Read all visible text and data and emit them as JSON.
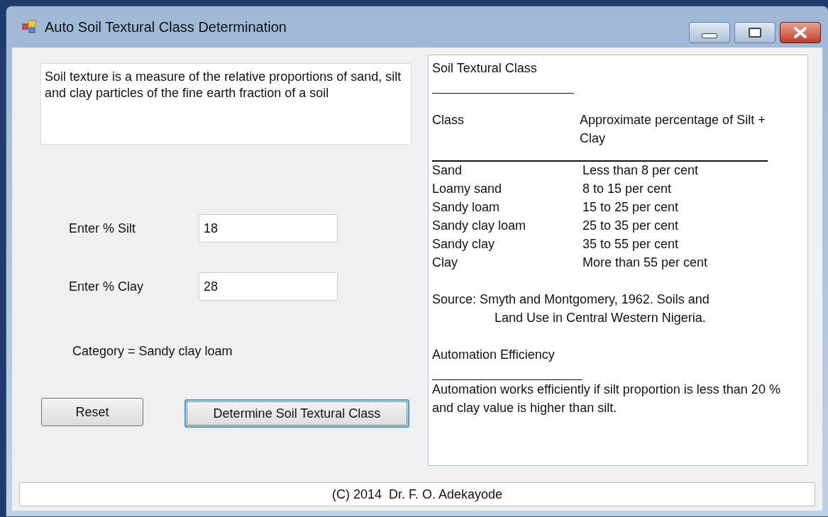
{
  "window": {
    "title": "Auto Soil Textural Class Determination"
  },
  "description": "Soil texture is a measure of the relative proportions of sand, silt and clay particles of the fine earth fraction of a soil",
  "fields": [
    {
      "label": "Enter % Silt",
      "value": "18"
    },
    {
      "label": "Enter % Clay",
      "value": "28"
    }
  ],
  "result": "Category = Sandy clay loam",
  "buttons": [
    {
      "label": "Reset",
      "focused": false
    },
    {
      "label": "Determine Soil Textural Class",
      "focused": true
    }
  ],
  "info_panel": {
    "heading": "Soil Textural Class",
    "columns": [
      "Class",
      "Approximate percentage of Silt + Clay"
    ],
    "rows": [
      {
        "class": "Sand",
        "range": "Less than 8 per cent"
      },
      {
        "class": "Loamy sand",
        "range": "8 to 15 per cent"
      },
      {
        "class": "Sandy loam",
        "range": "15 to 25 per cent"
      },
      {
        "class": "Sandy clay loam",
        "range": "25 to 35 per cent"
      },
      {
        "class": "Sandy clay",
        "range": "35 to 55 per cent"
      },
      {
        "class": "Clay",
        "range": "More than 55 per cent"
      }
    ],
    "source_lines": [
      "Source: Smyth and Montgomery, 1962. Soils and",
      "Land Use in Central Western Nigeria."
    ],
    "efficiency_heading": "Automation Efficiency",
    "efficiency_note": "Automation works efficiently if silt proportion is less than 20 % and clay value is higher than silt."
  },
  "footer": "(C) 2014  Dr. F. O. Adekayode"
}
